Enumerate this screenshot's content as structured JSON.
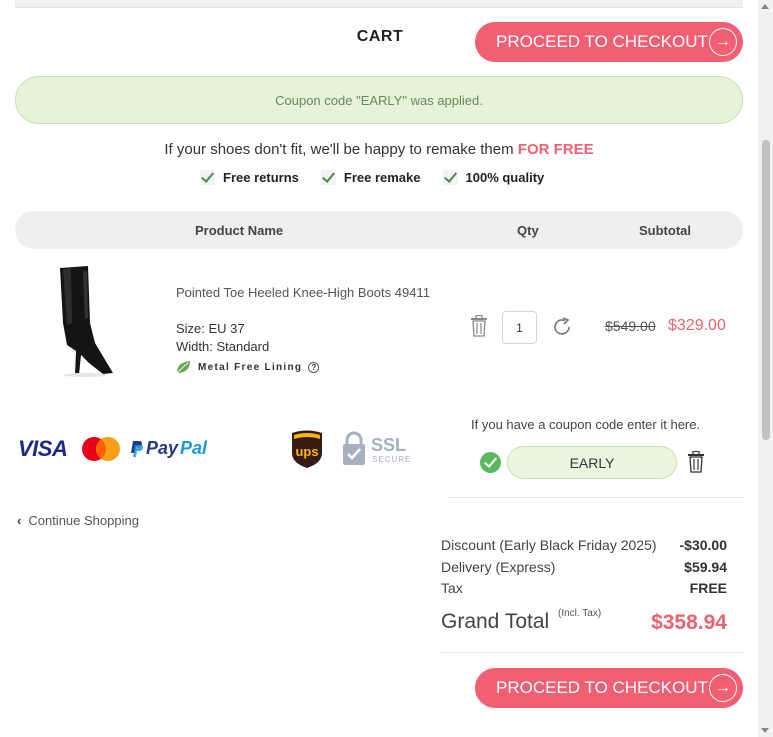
{
  "header": {
    "cart_title": "CART",
    "checkout_label": "PROCEED TO CHECKOUT",
    "arrow_icon": "arrow-right-circle-icon"
  },
  "coupon_banner": {
    "message": "Coupon code \"EARLY\" was applied."
  },
  "promise": {
    "text": "If your shoes don't fit, we'll be happy to remake them ",
    "highlight": "FOR FREE",
    "highlight_color": "#f25f73"
  },
  "features": [
    {
      "label": "Free returns"
    },
    {
      "label": "Free remake"
    },
    {
      "label": "100% quality"
    }
  ],
  "table": {
    "headers": {
      "product": "Product Name",
      "qty": "Qty",
      "subtotal": "Subtotal"
    }
  },
  "item": {
    "name": "Pointed Toe Heeled Knee-High Boots 49411",
    "size": "Size: EU 37",
    "width": "Width: Standard",
    "lining": "Metal Free Lining",
    "help_glyph": "?",
    "qty": "1",
    "old_price": "$549.00",
    "new_price": "$329.00"
  },
  "payment": {
    "visa": "VISA",
    "paypal_pay": "Pay",
    "paypal_pal": "Pal",
    "ups": "ups",
    "ssl": "SSL",
    "secure": "SECURE"
  },
  "coupon": {
    "hint": "If you have a coupon code enter it here.",
    "code": "EARLY"
  },
  "continue_label": "Continue Shopping",
  "summary": {
    "discount_label": "Discount (Early Black Friday 2025)",
    "discount_value": "-$30.00",
    "delivery_label": "Delivery (Express)",
    "delivery_value": "$59.94",
    "tax_label": "Tax",
    "tax_value": "FREE",
    "grand_label": "Grand Total",
    "grand_note": "(Incl. Tax)",
    "grand_value": "$358.94"
  },
  "colors": {
    "accent": "#f25f73",
    "success": "#5cb85c",
    "banner_bg": "#e5f3d8"
  }
}
